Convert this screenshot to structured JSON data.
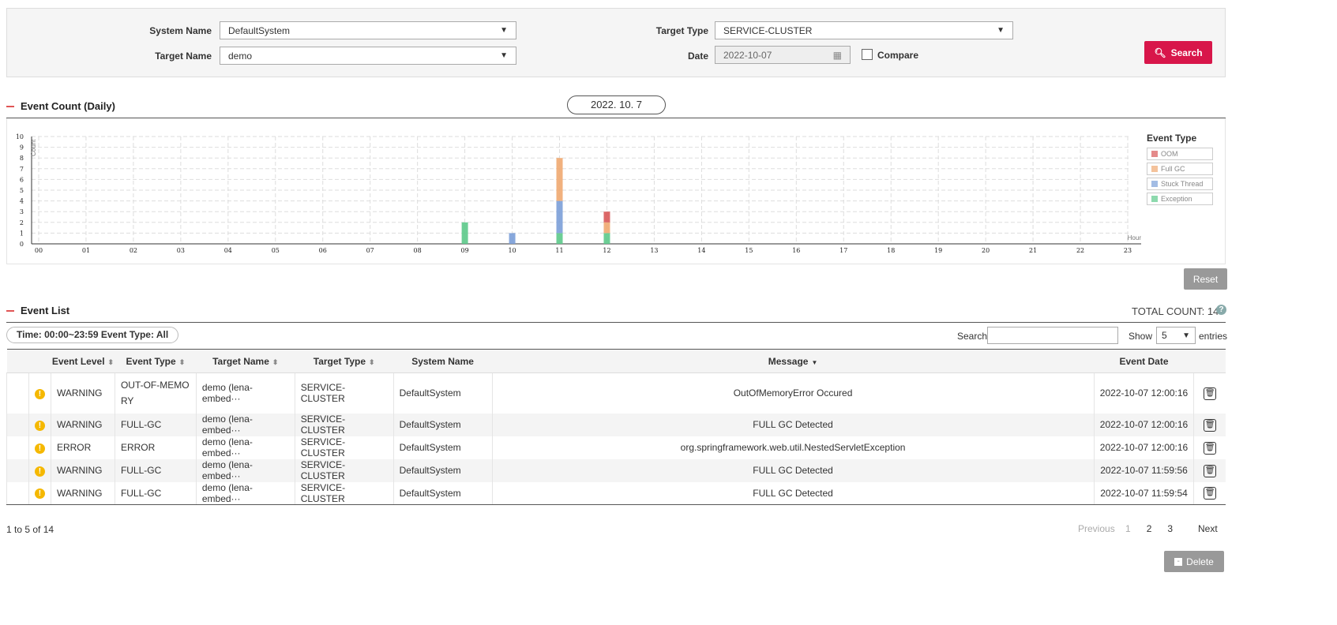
{
  "filters": {
    "system_name_label": "System Name",
    "system_name_value": "DefaultSystem",
    "target_name_label": "Target Name",
    "target_name_value": "demo",
    "target_type_label": "Target Type",
    "target_type_value": "SERVICE-CLUSTER",
    "date_label": "Date",
    "date_value": "2022-10-07",
    "compare_label": "Compare",
    "compare_checked": false,
    "search_label": "Search"
  },
  "event_count": {
    "title": "Event Count (Daily)",
    "date_pill": "2022. 10. 7",
    "reset_label": "Reset"
  },
  "chart_data": {
    "type": "bar",
    "stacked": true,
    "ylabel": "Count",
    "xlabel": "Hour",
    "ylim": [
      0,
      10
    ],
    "yticks": [
      "0",
      "1",
      "2",
      "3",
      "4",
      "5",
      "6",
      "7",
      "8",
      "9",
      "10"
    ],
    "grid": true,
    "legend_title": "Event Type",
    "legend_position": "right",
    "categories": [
      "00",
      "01",
      "02",
      "03",
      "04",
      "05",
      "06",
      "07",
      "08",
      "09",
      "10",
      "11",
      "12",
      "13",
      "14",
      "15",
      "16",
      "17",
      "18",
      "19",
      "20",
      "21",
      "22",
      "23"
    ],
    "series": [
      {
        "name": "Exception",
        "color": "#5cc98a",
        "values": [
          0,
          0,
          0,
          0,
          0,
          0,
          0,
          0,
          0,
          2,
          0,
          1,
          1,
          0,
          0,
          0,
          0,
          0,
          0,
          0,
          0,
          0,
          0,
          0
        ]
      },
      {
        "name": "Stuck Thread",
        "color": "#7b9fd8",
        "values": [
          0,
          0,
          0,
          0,
          0,
          0,
          0,
          0,
          0,
          0,
          1,
          3,
          0,
          0,
          0,
          0,
          0,
          0,
          0,
          0,
          0,
          0,
          0,
          0
        ]
      },
      {
        "name": "Full GC",
        "color": "#f0a870",
        "values": [
          0,
          0,
          0,
          0,
          0,
          0,
          0,
          0,
          0,
          0,
          0,
          4,
          1,
          0,
          0,
          0,
          0,
          0,
          0,
          0,
          0,
          0,
          0,
          0
        ]
      },
      {
        "name": "OOM",
        "color": "#d85858",
        "values": [
          0,
          0,
          0,
          0,
          0,
          0,
          0,
          0,
          0,
          0,
          0,
          0,
          1,
          0,
          0,
          0,
          0,
          0,
          0,
          0,
          0,
          0,
          0,
          0
        ]
      }
    ],
    "legend_order": [
      "OOM",
      "Full GC",
      "Stuck Thread",
      "Exception"
    ]
  },
  "event_list": {
    "title": "Event List",
    "total_count": "TOTAL COUNT: 14",
    "filter_pill": "Time: 00:00~23:59 Event Type: All",
    "search_label": "Search",
    "search_value": "",
    "show_label": "Show",
    "show_value": "5",
    "entries_label": "entries",
    "columns": [
      "",
      "Event Level",
      "Event Type",
      "Target Name",
      "Target Type",
      "System Name",
      "Message",
      "Event Date",
      ""
    ],
    "rows": [
      [
        "WARNING",
        "OUT-OF-MEMORY",
        "demo (lena-embed···",
        "SERVICE-CLUSTER",
        "DefaultSystem",
        "OutOfMemoryError Occured",
        "2022-10-07 12:00:16"
      ],
      [
        "WARNING",
        "FULL-GC",
        "demo (lena-embed···",
        "SERVICE-CLUSTER",
        "DefaultSystem",
        "FULL GC Detected",
        "2022-10-07 12:00:16"
      ],
      [
        "ERROR",
        "ERROR",
        "demo (lena-embed···",
        "SERVICE-CLUSTER",
        "DefaultSystem",
        "org.springframework.web.util.NestedServletException",
        "2022-10-07 12:00:16"
      ],
      [
        "WARNING",
        "FULL-GC",
        "demo (lena-embed···",
        "SERVICE-CLUSTER",
        "DefaultSystem",
        "FULL GC Detected",
        "2022-10-07 11:59:56"
      ],
      [
        "WARNING",
        "FULL-GC",
        "demo (lena-embed···",
        "SERVICE-CLUSTER",
        "DefaultSystem",
        "FULL GC Detected",
        "2022-10-07 11:59:54"
      ]
    ],
    "info": "1 to 5 of 14",
    "pagination": {
      "previous": "Previous",
      "pages": [
        "1",
        "2",
        "3"
      ],
      "current": "1",
      "next": "Next"
    },
    "delete_label": "Delete"
  }
}
